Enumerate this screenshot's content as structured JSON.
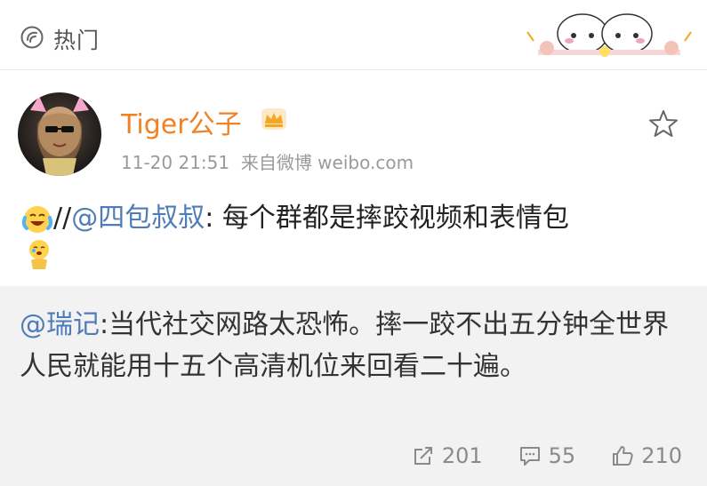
{
  "header": {
    "title": "热门"
  },
  "post": {
    "username": "Tiger公子",
    "time": "11-20 21:51",
    "source": "来自微博 weibo.com",
    "content_prefix": "//",
    "mention": "@四包叔叔",
    "content_text": ": 每个群都是摔跤视频和表情包"
  },
  "repost": {
    "mention": "@瑞记",
    "text": ":当代社交网路太恐怖。摔一跤不出五分钟全世界人民就能用十五个高清机位来回看二十遍。"
  },
  "actions": {
    "repost_count": "201",
    "comment_count": "55",
    "like_count": "210"
  },
  "colors": {
    "username": "#f08224",
    "mention": "#4e7cb7",
    "repost_bg": "#f2f2f2"
  },
  "icons": [
    "hot-icon",
    "crown-icon",
    "star-icon",
    "laugh-cry-emoji",
    "crying-emoji",
    "repost-icon",
    "comment-icon",
    "like-icon"
  ]
}
